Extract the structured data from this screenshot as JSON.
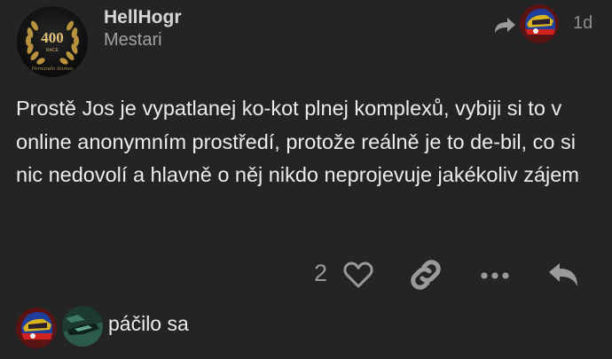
{
  "post": {
    "author": {
      "username": "HellHogr",
      "title": "Mestari",
      "avatar_number": "400",
      "avatar_word": "RACE",
      "avatar_signature": "Fernando Alonso"
    },
    "date": "1d",
    "body": "Prostě Jos je vypatlanej ko-kot plnej komplexů, vybiji si to v online anonymním prostředí, protože reálně je to de-bil, co si nic nedovolí a hlavně o něj nikdo neprojevuje jakékoliv zájem",
    "actions": {
      "like_count": "2",
      "like_icon": "heart-icon",
      "share_icon": "link-icon",
      "more_icon": "ellipsis-icon",
      "reply_icon": "reply-icon"
    },
    "likes": {
      "text": "páčilo sa"
    }
  },
  "colors": {
    "background": "#242424",
    "text": "#ececec",
    "muted": "#9a9a9a",
    "username": "#d6d6d6"
  }
}
